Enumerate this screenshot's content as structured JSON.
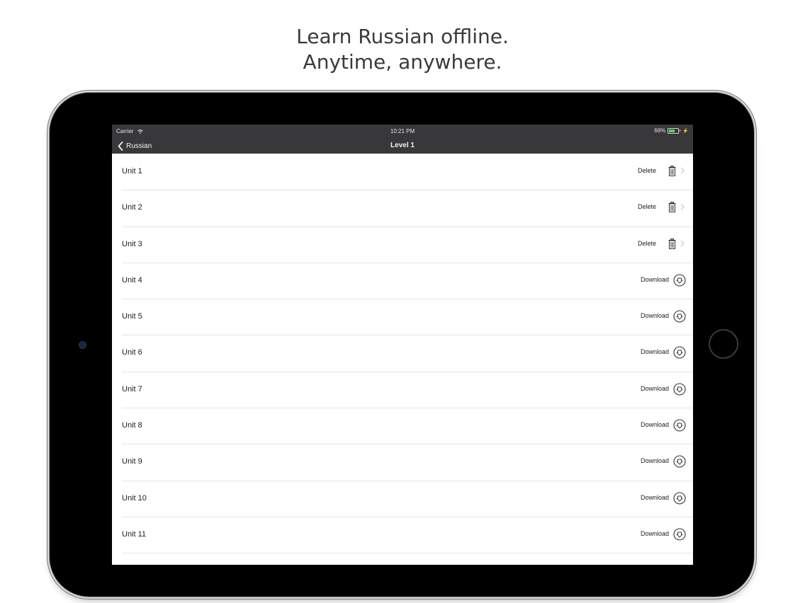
{
  "headline": {
    "line1": "Learn Russian offline.",
    "line2": "Anytime, anywhere."
  },
  "statusbar": {
    "carrier": "Carrier",
    "time": "10:21 PM",
    "battery": "66%",
    "battery_level": 0.66
  },
  "navbar": {
    "back_label": "Russian",
    "title": "Level 1"
  },
  "units": [
    {
      "label": "Unit 1",
      "action": "Delete",
      "state": "downloaded"
    },
    {
      "label": "Unit 2",
      "action": "Delete",
      "state": "downloaded"
    },
    {
      "label": "Unit 3",
      "action": "Delete",
      "state": "downloaded"
    },
    {
      "label": "Unit 4",
      "action": "Download",
      "state": "available"
    },
    {
      "label": "Unit 5",
      "action": "Download",
      "state": "available"
    },
    {
      "label": "Unit 6",
      "action": "Download",
      "state": "available"
    },
    {
      "label": "Unit 7",
      "action": "Download",
      "state": "available"
    },
    {
      "label": "Unit 8",
      "action": "Download",
      "state": "available"
    },
    {
      "label": "Unit 9",
      "action": "Download",
      "state": "available"
    },
    {
      "label": "Unit 10",
      "action": "Download",
      "state": "available"
    },
    {
      "label": "Unit 11",
      "action": "Download",
      "state": "available"
    }
  ],
  "colors": {
    "navbar_bg": "#38383a",
    "battery_fill": "#4cd964"
  },
  "icons": {
    "back": "chevron-left-icon",
    "delete": "trash-icon",
    "open": "chevron-right-icon",
    "download": "download-circle-icon"
  }
}
